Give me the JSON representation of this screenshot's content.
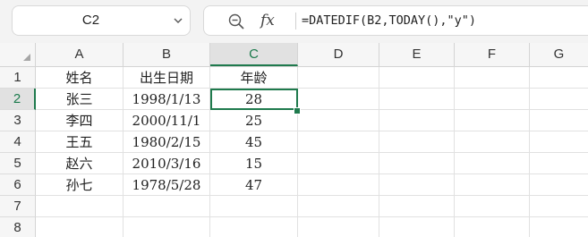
{
  "name_box": {
    "value": "C2"
  },
  "formula": {
    "text": "=DATEDIF(B2,TODAY(),\"y\")",
    "fx_label": "fx",
    "icons": [
      "zoom-formula-icon",
      "fx-icon",
      "chevron-down-icon"
    ]
  },
  "columns": [
    "A",
    "B",
    "C",
    "D",
    "E",
    "F",
    "G"
  ],
  "rows": [
    "1",
    "2",
    "3",
    "4",
    "5",
    "6",
    "7",
    "8"
  ],
  "active_cell": {
    "column": "C",
    "row": "2"
  },
  "table": {
    "headers": [
      "姓名",
      "出生日期",
      "年龄"
    ],
    "records": [
      [
        "张三",
        "1998/1/13",
        "28"
      ],
      [
        "李四",
        "2000/11/1",
        "25"
      ],
      [
        "王五",
        "1980/2/15",
        "45"
      ],
      [
        "赵六",
        "2010/3/16",
        "15"
      ],
      [
        "孙七",
        "1978/5/28",
        "47"
      ]
    ]
  },
  "colors": {
    "accent": "#1f7a4d",
    "header_bg": "#f6f6f6",
    "active_header_bg": "#e1e1e1",
    "toolbar_bg": "#f3f3f3"
  }
}
